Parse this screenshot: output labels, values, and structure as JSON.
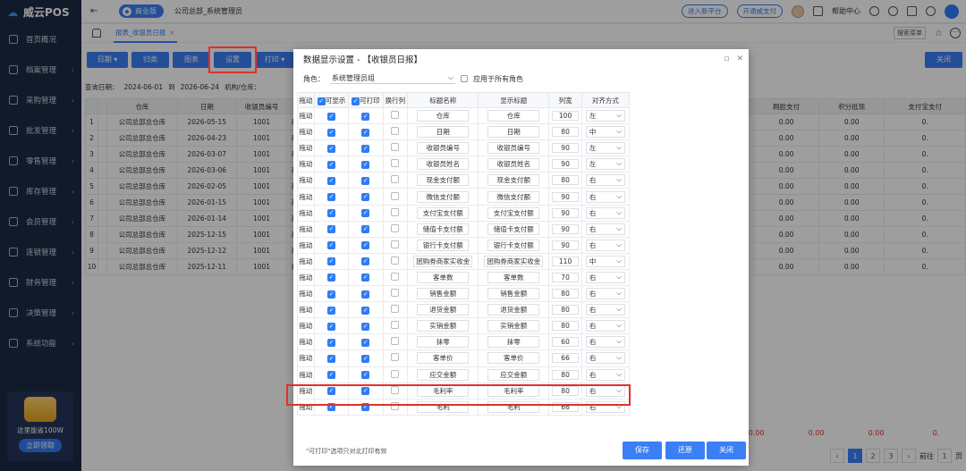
{
  "app": {
    "logo": "威云POS",
    "edition": "商业版",
    "org": "公司总部_系统管理员",
    "pill1": "进入新平台",
    "pill2": "开通威支付",
    "help": "帮助中心"
  },
  "sidebar": {
    "items": [
      {
        "label": "首页概况"
      },
      {
        "label": "档案管理"
      },
      {
        "label": "采购管理"
      },
      {
        "label": "批发管理"
      },
      {
        "label": "零售管理"
      },
      {
        "label": "库存管理"
      },
      {
        "label": "会员管理"
      },
      {
        "label": "连锁管理"
      },
      {
        "label": "财务管理"
      },
      {
        "label": "决策管理"
      },
      {
        "label": "系统功能"
      }
    ],
    "promo_text": "这里能省100W",
    "promo_btn": "立即领取"
  },
  "tabs": {
    "active": "报表_收银员日报",
    "search_menu": "搜索菜单"
  },
  "toolbar": {
    "b1": "日期",
    "b2": "归类",
    "b3": "图表",
    "b4": "设置",
    "b5": "打印",
    "close": "关闭"
  },
  "filter": {
    "label": "查询日期：",
    "from": "2024-06-01",
    "to_label": "到",
    "to": "2026-06-24",
    "org": "机构/仓库："
  },
  "grid": {
    "headers": [
      "",
      "",
      "仓库",
      "日期",
      "收银员编号",
      "收"
    ],
    "rows": [
      {
        "i": "1",
        "wh": "公司总部总仓库",
        "date": "2026-05-15",
        "no": "1001",
        "s": "系统"
      },
      {
        "i": "2",
        "wh": "公司总部总仓库",
        "date": "2026-04-23",
        "no": "1001",
        "s": "系统"
      },
      {
        "i": "3",
        "wh": "公司总部总仓库",
        "date": "2026-03-07",
        "no": "1001",
        "s": "系统"
      },
      {
        "i": "4",
        "wh": "公司总部总仓库",
        "date": "2026-03-06",
        "no": "1001",
        "s": "系统"
      },
      {
        "i": "5",
        "wh": "公司总部总仓库",
        "date": "2026-02-05",
        "no": "1001",
        "s": "系统"
      },
      {
        "i": "6",
        "wh": "公司总部总仓库",
        "date": "2026-01-15",
        "no": "1001",
        "s": "系统"
      },
      {
        "i": "7",
        "wh": "公司总部总仓库",
        "date": "2026-01-14",
        "no": "1001",
        "s": "系统"
      },
      {
        "i": "8",
        "wh": "公司总部总仓库",
        "date": "2025-12-15",
        "no": "1001",
        "s": "系统"
      },
      {
        "i": "9",
        "wh": "公司总部总仓库",
        "date": "2025-12-12",
        "no": "1001",
        "s": "系统"
      },
      {
        "i": "10",
        "wh": "公司总部总仓库",
        "date": "2025-12-11",
        "no": "1001",
        "s": "系统"
      }
    ]
  },
  "grid2": {
    "headers": [
      "支付",
      "信用卡",
      "刷脸支付",
      "积分抵现",
      "支付宝支付"
    ],
    "cell": "0.00",
    "last": "0.",
    "total": "0.00"
  },
  "pager": {
    "p1": "1",
    "p2": "2",
    "p3": "3",
    "prev": "前往",
    "page": "1",
    "unit": "页"
  },
  "dialog": {
    "title": "数据显示设置 - 【收银员日报】",
    "role_label": "角色：",
    "role_value": "系统管理员组",
    "apply_all": "应用于所有角色",
    "headers": {
      "drag": "拖动",
      "show": "可显示",
      "print": "可打印",
      "wrap": "换行列",
      "title": "标题名称",
      "disp": "显示标题",
      "width": "列宽",
      "align": "对齐方式"
    },
    "rows": [
      {
        "drag": "拖动",
        "title": "仓库",
        "disp": "仓库",
        "w": "100",
        "a": "左"
      },
      {
        "drag": "拖动",
        "title": "日期",
        "disp": "日期",
        "w": "80",
        "a": "中"
      },
      {
        "drag": "拖动",
        "title": "收银员编号",
        "disp": "收银员编号",
        "w": "90",
        "a": "左"
      },
      {
        "drag": "拖动",
        "title": "收银员姓名",
        "disp": "收银员姓名",
        "w": "90",
        "a": "左"
      },
      {
        "drag": "拖动",
        "title": "现金支付额",
        "disp": "现金支付额",
        "w": "80",
        "a": "右"
      },
      {
        "drag": "拖动",
        "title": "微信支付额",
        "disp": "微信支付额",
        "w": "90",
        "a": "右"
      },
      {
        "drag": "拖动",
        "title": "支付宝支付额",
        "disp": "支付宝支付额",
        "w": "90",
        "a": "右"
      },
      {
        "drag": "拖动",
        "title": "储值卡支付额",
        "disp": "储值卡支付额",
        "w": "90",
        "a": "右"
      },
      {
        "drag": "拖动",
        "title": "银行卡支付额",
        "disp": "银行卡支付额",
        "w": "90",
        "a": "右"
      },
      {
        "drag": "拖动",
        "title": "团购券商家实收金",
        "disp": "团购券商家实收金",
        "w": "110",
        "a": "中"
      },
      {
        "drag": "拖动",
        "title": "客单数",
        "disp": "客单数",
        "w": "70",
        "a": "右"
      },
      {
        "drag": "拖动",
        "title": "销售金额",
        "disp": "销售金额",
        "w": "80",
        "a": "右"
      },
      {
        "drag": "拖动",
        "title": "退货金额",
        "disp": "退货金额",
        "w": "80",
        "a": "右"
      },
      {
        "drag": "拖动",
        "title": "实销金额",
        "disp": "实销金额",
        "w": "80",
        "a": "右"
      },
      {
        "drag": "拖动",
        "title": "抹零",
        "disp": "抹零",
        "w": "60",
        "a": "右"
      },
      {
        "drag": "拖动",
        "title": "客单价",
        "disp": "客单价",
        "w": "66",
        "a": "右"
      },
      {
        "drag": "拖动",
        "title": "应交金额",
        "disp": "应交金额",
        "w": "80",
        "a": "右"
      },
      {
        "drag": "拖动",
        "title": "毛利率",
        "disp": "毛利率",
        "w": "80",
        "a": "右"
      },
      {
        "drag": "拖动",
        "title": "毛利",
        "disp": "毛利",
        "w": "66",
        "a": "右"
      }
    ],
    "note": "\"可打印\"选项只对北打印有效",
    "save": "保存",
    "restore": "还原",
    "close": "关闭"
  }
}
